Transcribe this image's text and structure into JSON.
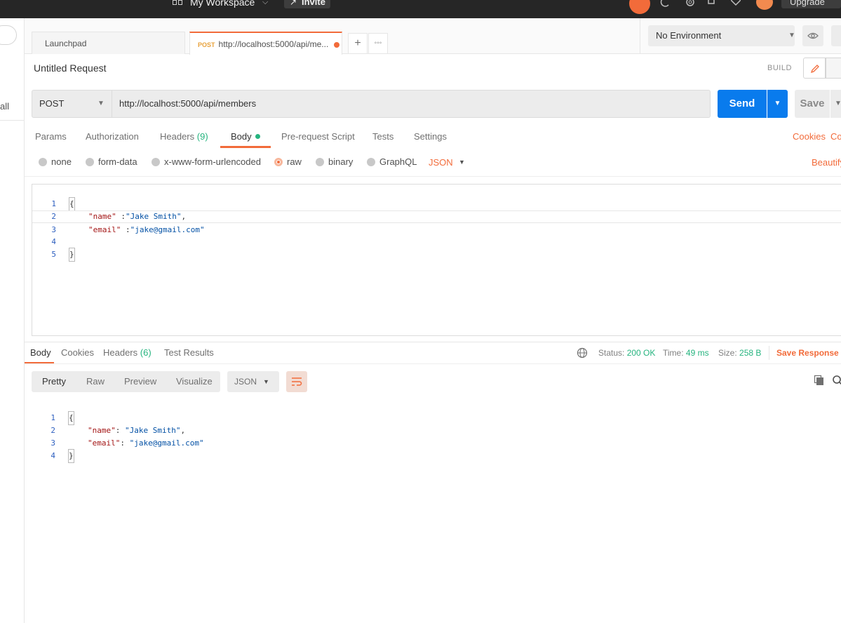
{
  "topbar": {
    "workspace_name": "My Workspace",
    "invite_label": "Invite",
    "upgrade_label": "Upgrade",
    "icons": [
      "grid-icon",
      "chevron-down-icon",
      "add-user-icon",
      "sync-icon",
      "satellite-icon",
      "settings-icon",
      "bell-icon",
      "heart-icon",
      "avatar"
    ]
  },
  "sidebar": {
    "fragment_text": "all"
  },
  "tabs": [
    {
      "label": "Launchpad"
    },
    {
      "method": "POST",
      "label": "http://localhost:5000/api/me...",
      "unsaved": true
    }
  ],
  "environment": {
    "selected": "No Environment"
  },
  "request": {
    "title": "Untitled Request",
    "mode_label": "BUILD",
    "method": "POST",
    "url": "http://localhost:5000/api/members",
    "send_label": "Send",
    "save_label": "Save",
    "sub_tabs": [
      {
        "label": "Params"
      },
      {
        "label": "Authorization"
      },
      {
        "label": "Headers",
        "count": "(9)"
      },
      {
        "label": "Body",
        "active": true
      },
      {
        "label": "Pre-request Script"
      },
      {
        "label": "Tests"
      },
      {
        "label": "Settings"
      }
    ],
    "cookies_label": "Cookies",
    "code_label": "Co",
    "body_types": [
      "none",
      "form-data",
      "x-www-form-urlencoded",
      "raw",
      "binary",
      "GraphQL"
    ],
    "body_type_selected": "raw",
    "format": "JSON",
    "beautify_label": "Beautify",
    "body_lines": [
      {
        "n": "1",
        "text": "{"
      },
      {
        "n": "2",
        "key": "\"name\"",
        "sep": " :",
        "value": "\"Jake Smith\"",
        "tail": ","
      },
      {
        "n": "3",
        "key": "\"email\"",
        "sep": " :",
        "value": "\"jake@gmail.com\"",
        "tail": ""
      },
      {
        "n": "4",
        "text": ""
      },
      {
        "n": "5",
        "text": "}"
      }
    ]
  },
  "response": {
    "tabs": [
      {
        "label": "Body",
        "active": true
      },
      {
        "label": "Cookies"
      },
      {
        "label": "Headers",
        "count": "(6)"
      },
      {
        "label": "Test Results"
      }
    ],
    "status_label": "Status:",
    "status_value": "200 OK",
    "time_label": "Time:",
    "time_value": "49 ms",
    "size_label": "Size:",
    "size_value": "258 B",
    "save_response_label": "Save Response",
    "views": [
      "Pretty",
      "Raw",
      "Preview",
      "Visualize"
    ],
    "view_selected": "Pretty",
    "format": "JSON",
    "lines": [
      {
        "n": "1",
        "text": "{"
      },
      {
        "n": "2",
        "key": "\"name\"",
        "sep": ": ",
        "value": "\"Jake Smith\"",
        "tail": ","
      },
      {
        "n": "3",
        "key": "\"email\"",
        "sep": ": ",
        "value": "\"jake@gmail.com\"",
        "tail": ""
      },
      {
        "n": "4",
        "text": "}"
      }
    ]
  },
  "colors": {
    "accent": "#f26b3a",
    "send_blue": "#097bed",
    "success_green": "#26b47f",
    "topbar": "#262626"
  }
}
